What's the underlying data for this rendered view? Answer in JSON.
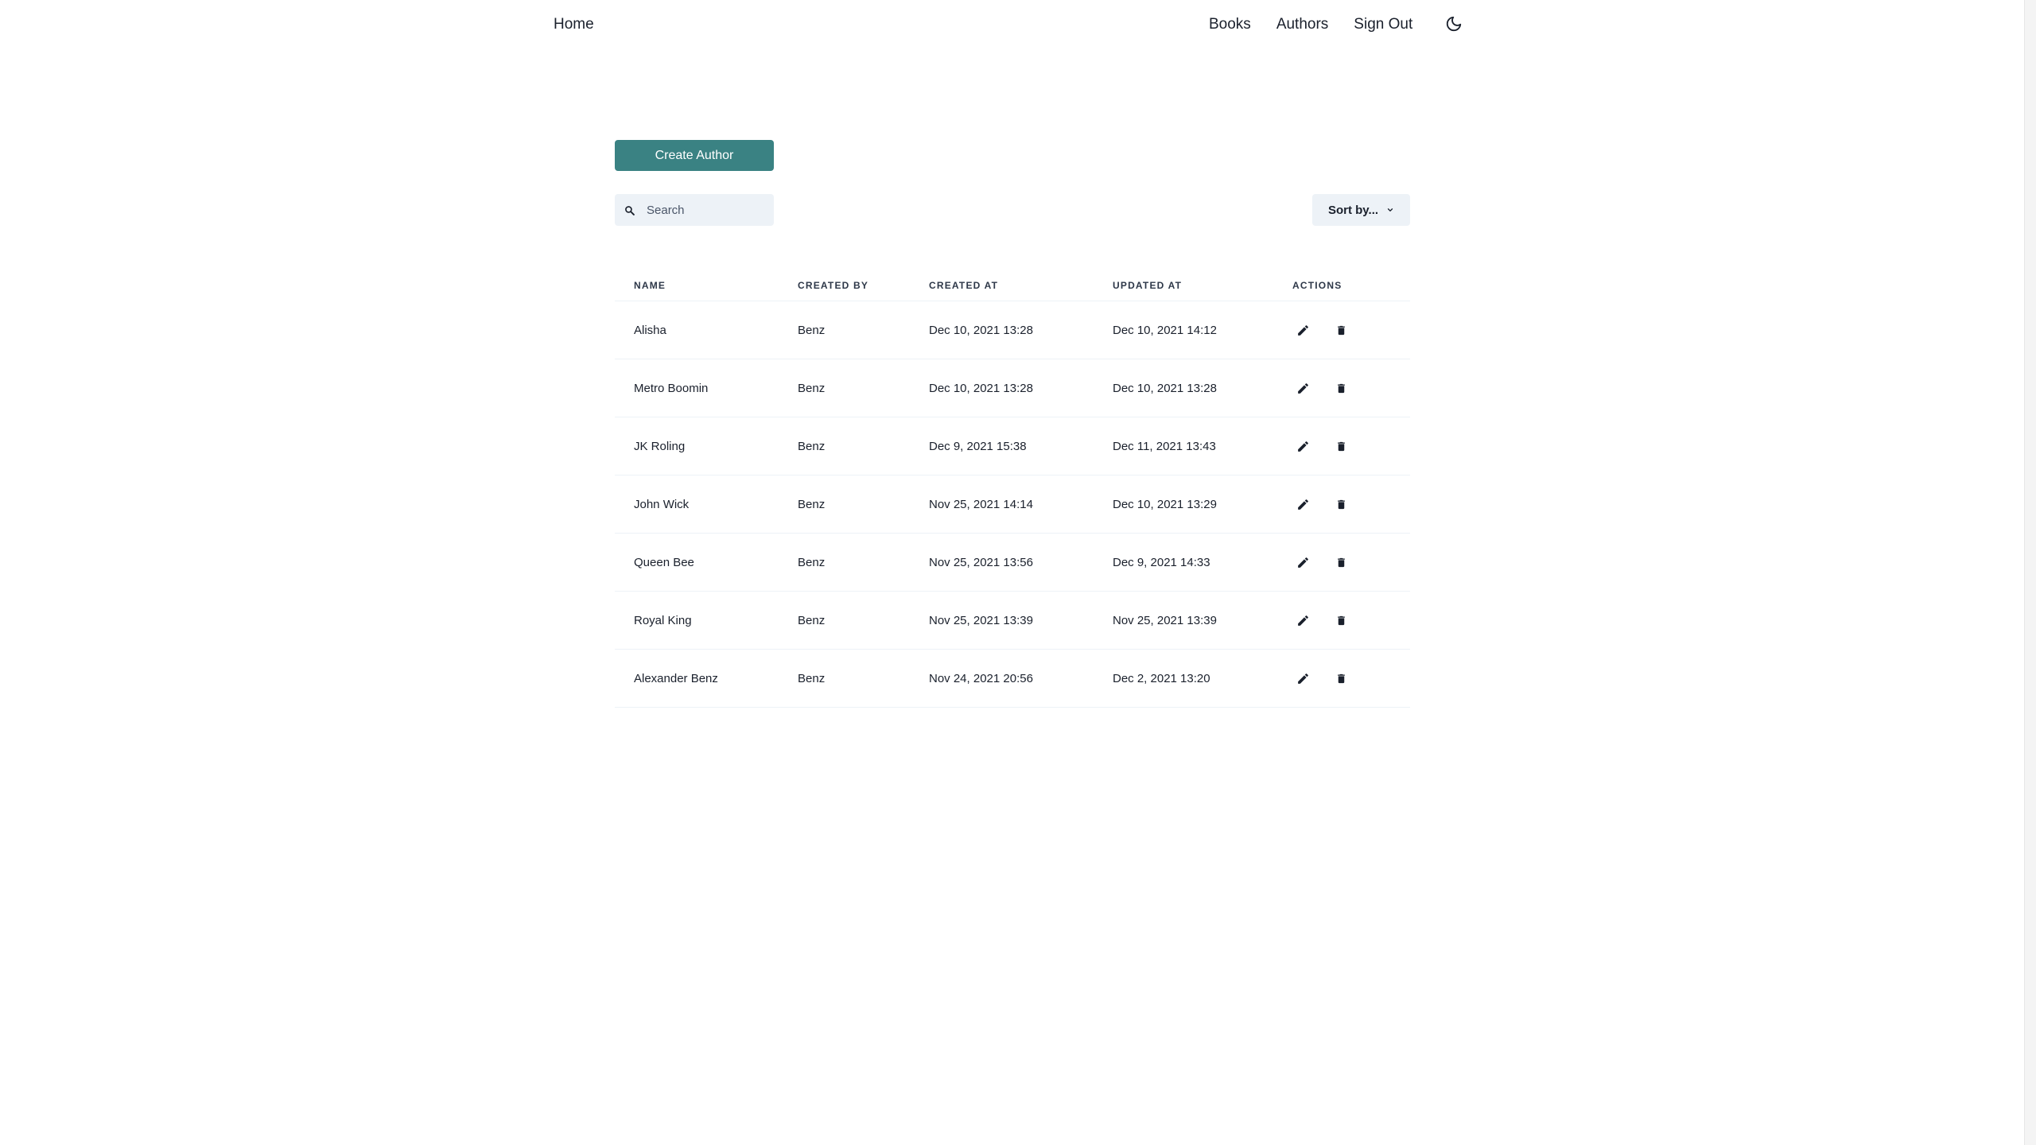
{
  "nav": {
    "home": "Home",
    "links": [
      "Books",
      "Authors",
      "Sign Out"
    ],
    "theme_icon": "moon-icon"
  },
  "toolbar": {
    "create_label": "Create Author",
    "search_placeholder": "Search",
    "search_value": "",
    "sort_label": "Sort by..."
  },
  "colors": {
    "accent": "#3a8283",
    "input_bg": "#edf2f7"
  },
  "table": {
    "headers": [
      "NAME",
      "CREATED BY",
      "CREATED AT",
      "UPDATED AT",
      "ACTIONS"
    ],
    "rows": [
      {
        "name": "Alisha",
        "created_by": "Benz",
        "created_at": "Dec 10, 2021 13:28",
        "updated_at": "Dec 10, 2021 14:12"
      },
      {
        "name": "Metro Boomin",
        "created_by": "Benz",
        "created_at": "Dec 10, 2021 13:28",
        "updated_at": "Dec 10, 2021 13:28"
      },
      {
        "name": "JK Roling",
        "created_by": "Benz",
        "created_at": "Dec 9, 2021 15:38",
        "updated_at": "Dec 11, 2021 13:43"
      },
      {
        "name": "John Wick",
        "created_by": "Benz",
        "created_at": "Nov 25, 2021 14:14",
        "updated_at": "Dec 10, 2021 13:29"
      },
      {
        "name": "Queen Bee",
        "created_by": "Benz",
        "created_at": "Nov 25, 2021 13:56",
        "updated_at": "Dec 9, 2021 14:33"
      },
      {
        "name": "Royal King",
        "created_by": "Benz",
        "created_at": "Nov 25, 2021 13:39",
        "updated_at": "Nov 25, 2021 13:39"
      },
      {
        "name": "Alexander Benz",
        "created_by": "Benz",
        "created_at": "Nov 24, 2021 20:56",
        "updated_at": "Dec 2, 2021 13:20"
      }
    ]
  }
}
